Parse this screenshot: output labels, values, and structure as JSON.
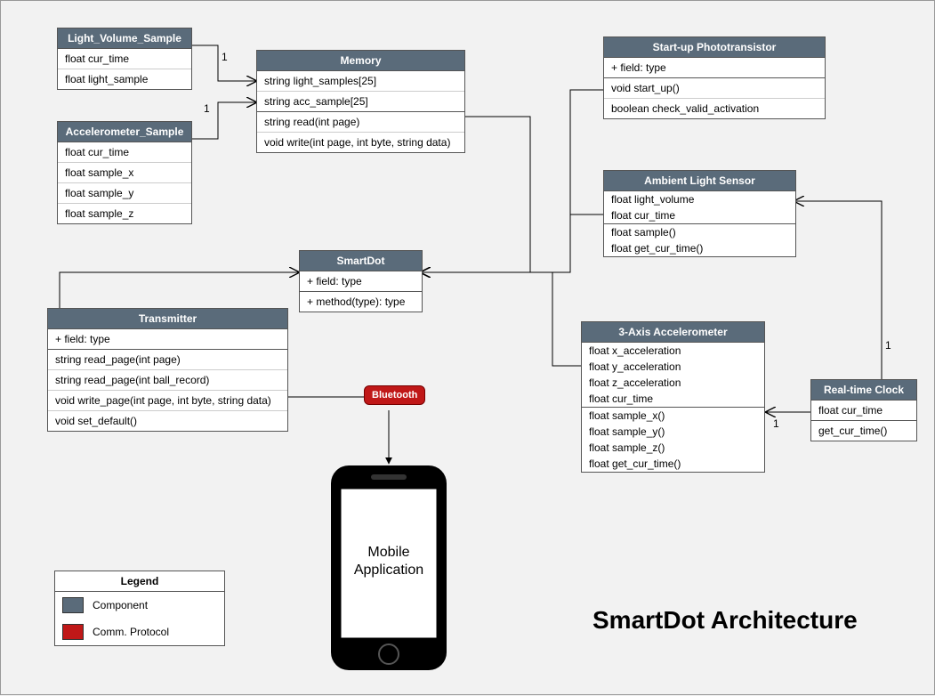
{
  "title": "SmartDot Architecture",
  "legend": {
    "title": "Legend",
    "component_label": "Component",
    "protocol_label": "Comm. Protocol",
    "component_color": "#5a6b7a",
    "protocol_color": "#c01818"
  },
  "bluetooth_label": "Bluetooth",
  "mobile_app_line1": "Mobile",
  "mobile_app_line2": "Application",
  "multiplicity_one": "1",
  "classes": {
    "light_volume_sample": {
      "title": "Light_Volume_Sample",
      "attrs": [
        "float cur_time",
        "float light_sample"
      ]
    },
    "accelerometer_sample": {
      "title": "Accelerometer_Sample",
      "attrs": [
        "float cur_time",
        "float sample_x",
        "float sample_y",
        "float sample_z"
      ]
    },
    "memory": {
      "title": "Memory",
      "attrs": [
        "string light_samples[25]",
        "string acc_sample[25]"
      ],
      "ops": [
        "string read(int page)",
        "void write(int page, int byte, string data)"
      ]
    },
    "startup_phototransistor": {
      "title": "Start-up Phototransistor",
      "attrs": [
        "+ field: type"
      ],
      "ops": [
        "void start_up()",
        "boolean check_valid_activation"
      ]
    },
    "ambient_light_sensor": {
      "title": "Ambient Light Sensor",
      "attrs": [
        "float light_volume",
        "float cur_time"
      ],
      "ops": [
        "float sample()",
        "float get_cur_time()"
      ]
    },
    "smartdot": {
      "title": "SmartDot",
      "attrs": [
        "+ field: type"
      ],
      "ops": [
        "+ method(type): type"
      ]
    },
    "transmitter": {
      "title": "Transmitter",
      "attrs": [
        "+ field: type"
      ],
      "ops": [
        "string read_page(int page)",
        "string read_page(int ball_record)",
        "void write_page(int page, int byte, string data)",
        "void set_default()"
      ]
    },
    "three_axis_accelerometer": {
      "title": "3-Axis Accelerometer",
      "attrs": [
        "float x_acceleration",
        "float y_acceleration",
        "float z_acceleration",
        "float cur_time"
      ],
      "ops": [
        "float sample_x()",
        "float sample_y()",
        "float sample_z()",
        "float get_cur_time()"
      ]
    },
    "realtime_clock": {
      "title": "Real-time Clock",
      "attrs": [
        "float cur_time"
      ],
      "ops": [
        "get_cur_time()"
      ]
    }
  },
  "chart_data": {
    "type": "diagram",
    "title": "SmartDot Architecture",
    "nodes": [
      {
        "id": "Light_Volume_Sample",
        "kind": "class"
      },
      {
        "id": "Accelerometer_Sample",
        "kind": "class"
      },
      {
        "id": "Memory",
        "kind": "class"
      },
      {
        "id": "Start-up Phototransistor",
        "kind": "class"
      },
      {
        "id": "Ambient Light Sensor",
        "kind": "class"
      },
      {
        "id": "SmartDot",
        "kind": "class"
      },
      {
        "id": "Transmitter",
        "kind": "class"
      },
      {
        "id": "3-Axis Accelerometer",
        "kind": "class"
      },
      {
        "id": "Real-time Clock",
        "kind": "class"
      },
      {
        "id": "Mobile Application",
        "kind": "device"
      },
      {
        "id": "Bluetooth",
        "kind": "protocol"
      }
    ],
    "edges": [
      {
        "from": "Memory",
        "to": "Light_Volume_Sample",
        "type": "composition",
        "multiplicity_to": "1"
      },
      {
        "from": "Memory",
        "to": "Accelerometer_Sample",
        "type": "composition",
        "multiplicity_to": "1"
      },
      {
        "from": "Memory",
        "to": "SmartDot",
        "type": "association"
      },
      {
        "from": "Start-up Phototransistor",
        "to": "SmartDot",
        "type": "association"
      },
      {
        "from": "Ambient Light Sensor",
        "to": "SmartDot",
        "type": "association"
      },
      {
        "from": "3-Axis Accelerometer",
        "to": "SmartDot",
        "type": "association"
      },
      {
        "from": "Transmitter",
        "to": "SmartDot",
        "type": "association"
      },
      {
        "from": "Real-time Clock",
        "to": "Ambient Light Sensor",
        "type": "composition",
        "multiplicity_to": "1"
      },
      {
        "from": "Real-time Clock",
        "to": "3-Axis Accelerometer",
        "type": "composition",
        "multiplicity_to": "1"
      },
      {
        "from": "Transmitter",
        "to": "Mobile Application",
        "type": "communication",
        "via": "Bluetooth"
      }
    ]
  }
}
